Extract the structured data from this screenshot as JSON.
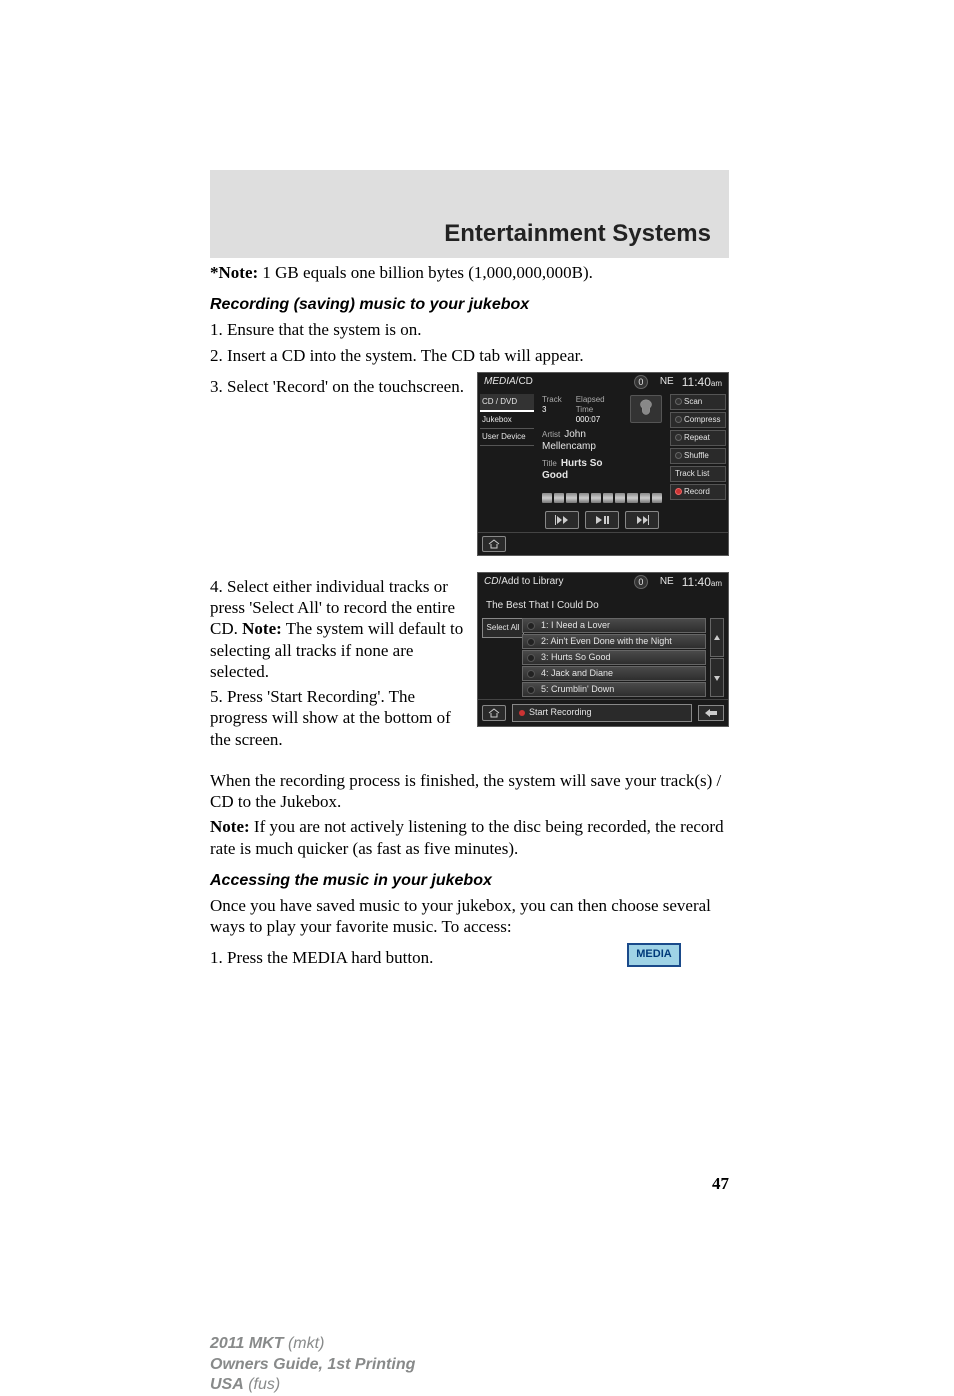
{
  "header": {
    "title": "Entertainment Systems"
  },
  "body": {
    "note1_bold": "*Note:",
    "note1_rest": " 1 GB equals one billion bytes (1,000,000,000B).",
    "sub1": "Recording (saving) music to your jukebox",
    "step1": "1. Ensure that the system is on.",
    "step2": "2. Insert a CD into the system. The CD tab will appear.",
    "step3": "3. Select 'Record' on the touchscreen.",
    "step4a": "4. Select either individual tracks or press 'Select All' to record the entire CD. ",
    "step4b_bold": "Note:",
    "step4b_rest": " The system will default to selecting all tracks if none are selected.",
    "step5": "5. Press 'Start Recording'. The progress will show at the bottom of the screen.",
    "after1": "When the recording process is finished, the system will save your track(s) / CD to the Jukebox.",
    "after2_bold": "Note:",
    "after2_rest": " If you are not actively listening to the disc being recorded, the record rate is much quicker (as fast as five minutes).",
    "sub2": "Accessing the music in your jukebox",
    "access1": "Once you have saved music to your jukebox, you can then choose several ways to play your favorite music. To access:",
    "access_step1": "1. Press the MEDIA hard button.",
    "media_button": "MEDIA"
  },
  "screen1": {
    "crumb1": "MEDIA",
    "crumb_sep": " / ",
    "crumb2": "CD",
    "fan": "0",
    "compass": "NE",
    "clock": "11:40",
    "ampm": "am",
    "tabs": [
      "CD / DVD",
      "Jukebox",
      "User Device"
    ],
    "meta": {
      "track_lbl": "Track",
      "track_val": "3",
      "time_lbl": "Elapsed Time",
      "time_val": "000:07"
    },
    "artist_lbl": "Artist",
    "artist_val": "John Mellencamp",
    "title_lbl": "Title",
    "title_val": "Hurts So Good",
    "right": [
      "Scan",
      "Compress",
      "Repeat",
      "Shuffle",
      "Track List",
      "Record"
    ]
  },
  "screen2": {
    "crumb1": "CD",
    "crumb_sep": " / ",
    "crumb2": "Add to Library",
    "fan": "0",
    "compass": "NE",
    "clock": "11:40",
    "ampm": "am",
    "album": "The Best That I Could Do",
    "select_all": "Select All",
    "tracks": [
      "1: I Need a Lover",
      "2: Ain't Even Done with the Night",
      "3: Hurts So Good",
      "4: Jack and Diane",
      "5: Crumblin' Down"
    ],
    "start": "Start Recording"
  },
  "page_num": "47",
  "footer": {
    "l1a": "2011 MKT",
    "l1b": " (mkt)",
    "l2": "Owners Guide, 1st Printing",
    "l3a": "USA",
    "l3b": " (fus)"
  }
}
